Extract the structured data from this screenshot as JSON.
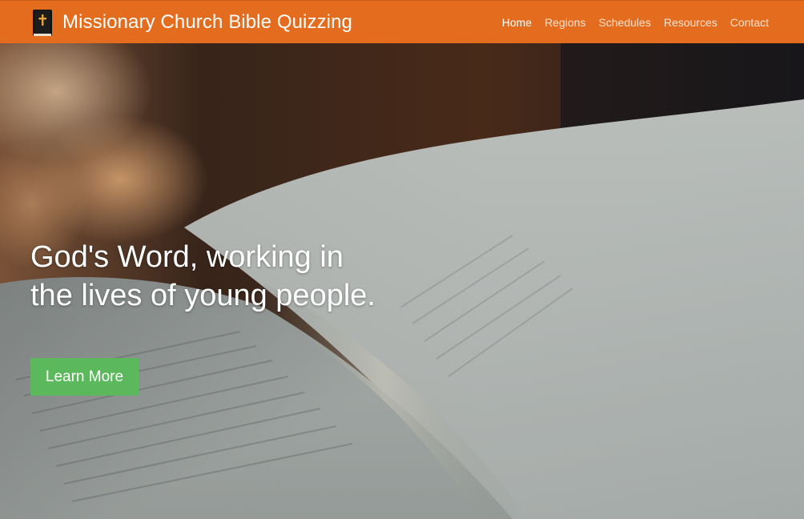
{
  "navbar": {
    "brand_title": "Missionary Church Bible Quizzing",
    "brand_icon": "bible-icon",
    "background_color": "#e36c1f",
    "links": [
      {
        "label": "Home",
        "active": true
      },
      {
        "label": "Regions",
        "active": false
      },
      {
        "label": "Schedules",
        "active": false
      },
      {
        "label": "Resources",
        "active": false
      },
      {
        "label": "Contact",
        "active": false
      }
    ]
  },
  "hero": {
    "background": "open-bible-photo",
    "headline_line1": "God's Word, working in",
    "headline_line2": "the lives of young people.",
    "cta_label": "Learn More",
    "cta_color": "#5cb85c"
  }
}
